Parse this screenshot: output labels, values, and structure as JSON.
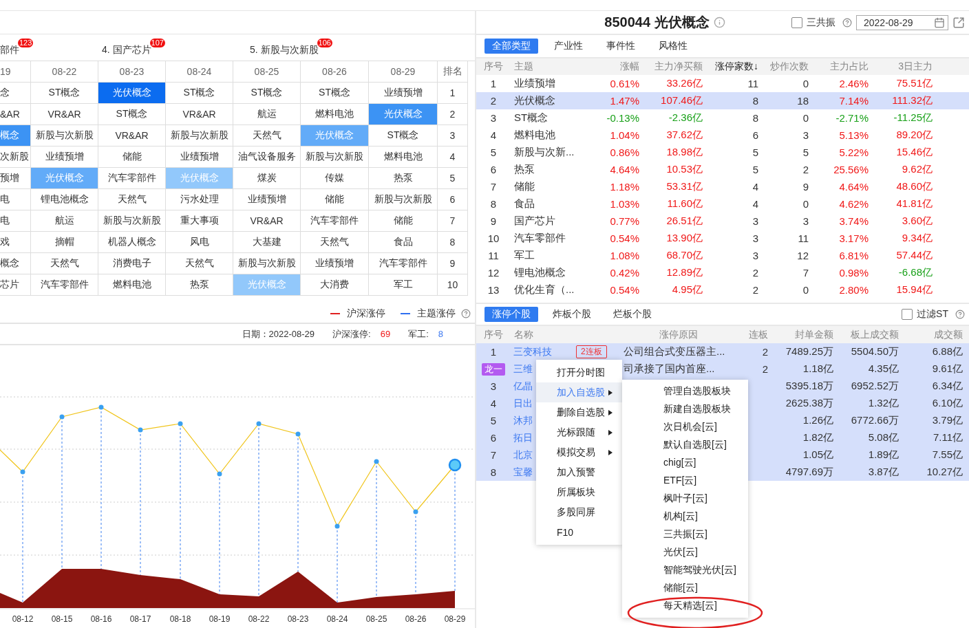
{
  "left_tabs": [
    {
      "label": "部件",
      "badge": "123"
    },
    {
      "label": "4. 国产芯片",
      "badge": "107"
    },
    {
      "label": "5. 新股与次新股",
      "badge": "106"
    }
  ],
  "rank_table": {
    "columns": [
      "19",
      "08-22",
      "08-23",
      "08-24",
      "08-25",
      "08-26",
      "08-29",
      "排名"
    ],
    "rows": [
      {
        "rank": "1",
        "cells": [
          {
            "text": "念",
            "selected": false
          },
          {
            "text": "ST概念",
            "selected": false
          },
          {
            "text": "光伏概念",
            "selected": true,
            "color": "#0b6cf0"
          },
          {
            "text": "ST概念",
            "selected": false
          },
          {
            "text": "ST概念",
            "selected": false
          },
          {
            "text": "ST概念",
            "selected": false
          },
          {
            "text": "业绩预增",
            "selected": false
          }
        ]
      },
      {
        "rank": "2",
        "cells": [
          {
            "text": "&AR",
            "selected": false
          },
          {
            "text": "VR&AR",
            "selected": false
          },
          {
            "text": "ST概念",
            "selected": false
          },
          {
            "text": "VR&AR",
            "selected": false
          },
          {
            "text": "航运",
            "selected": false
          },
          {
            "text": "燃料电池",
            "selected": false
          },
          {
            "text": "光伏概念",
            "selected": true,
            "color": "#3c93f4"
          }
        ]
      },
      {
        "rank": "3",
        "cells": [
          {
            "text": "概念",
            "selected": true,
            "color": "#3c93f4"
          },
          {
            "text": "新股与次新股",
            "selected": false
          },
          {
            "text": "VR&AR",
            "selected": false
          },
          {
            "text": "新股与次新股",
            "selected": false
          },
          {
            "text": "天然气",
            "selected": false
          },
          {
            "text": "光伏概念",
            "selected": true,
            "color": "#62abf8"
          },
          {
            "text": "ST概念",
            "selected": false
          }
        ]
      },
      {
        "rank": "4",
        "cells": [
          {
            "text": "次新股",
            "selected": false
          },
          {
            "text": "业绩预增",
            "selected": false
          },
          {
            "text": "储能",
            "selected": false
          },
          {
            "text": "业绩预增",
            "selected": false
          },
          {
            "text": "油气设备服务",
            "selected": false
          },
          {
            "text": "新股与次新股",
            "selected": false
          },
          {
            "text": "燃料电池",
            "selected": false
          }
        ]
      },
      {
        "rank": "5",
        "cells": [
          {
            "text": "预增",
            "selected": false
          },
          {
            "text": "光伏概念",
            "selected": true,
            "color": "#62abf8"
          },
          {
            "text": "汽车零部件",
            "selected": false
          },
          {
            "text": "光伏概念",
            "selected": true,
            "color": "#92c8fb"
          },
          {
            "text": "煤炭",
            "selected": false
          },
          {
            "text": "传媒",
            "selected": false
          },
          {
            "text": "热泵",
            "selected": false
          }
        ]
      },
      {
        "rank": "6",
        "cells": [
          {
            "text": "电",
            "selected": false
          },
          {
            "text": "锂电池概念",
            "selected": false
          },
          {
            "text": "天然气",
            "selected": false
          },
          {
            "text": "污水处理",
            "selected": false
          },
          {
            "text": "业绩预增",
            "selected": false
          },
          {
            "text": "储能",
            "selected": false
          },
          {
            "text": "新股与次新股",
            "selected": false
          }
        ]
      },
      {
        "rank": "7",
        "cells": [
          {
            "text": "电",
            "selected": false
          },
          {
            "text": "航运",
            "selected": false
          },
          {
            "text": "新股与次新股",
            "selected": false
          },
          {
            "text": "重大事项",
            "selected": false
          },
          {
            "text": "VR&AR",
            "selected": false
          },
          {
            "text": "汽车零部件",
            "selected": false
          },
          {
            "text": "储能",
            "selected": false
          }
        ]
      },
      {
        "rank": "8",
        "cells": [
          {
            "text": "戏",
            "selected": false
          },
          {
            "text": "摘帽",
            "selected": false
          },
          {
            "text": "机器人概念",
            "selected": false
          },
          {
            "text": "风电",
            "selected": false
          },
          {
            "text": "大基建",
            "selected": false
          },
          {
            "text": "天然气",
            "selected": false
          },
          {
            "text": "食品",
            "selected": false
          }
        ]
      },
      {
        "rank": "9",
        "cells": [
          {
            "text": "概念",
            "selected": false
          },
          {
            "text": "天然气",
            "selected": false
          },
          {
            "text": "消费电子",
            "selected": false
          },
          {
            "text": "天然气",
            "selected": false
          },
          {
            "text": "新股与次新股",
            "selected": false
          },
          {
            "text": "业绩预增",
            "selected": false
          },
          {
            "text": "汽车零部件",
            "selected": false
          }
        ]
      },
      {
        "rank": "10",
        "cells": [
          {
            "text": "芯片",
            "selected": false
          },
          {
            "text": "汽车零部件",
            "selected": false
          },
          {
            "text": "燃料电池",
            "selected": false
          },
          {
            "text": "热泵",
            "selected": false
          },
          {
            "text": "光伏概念",
            "selected": true,
            "color": "#92c8fb"
          },
          {
            "text": "大消费",
            "selected": false
          },
          {
            "text": "军工",
            "selected": false
          }
        ]
      }
    ]
  },
  "legend": [
    {
      "label": "沪深涨停",
      "color": "#e02020"
    },
    {
      "label": "主题涨停",
      "color": "#2f6ff0"
    }
  ],
  "info": {
    "date": "日期：2022-08-29",
    "stats": [
      {
        "label": "沪深涨停:",
        "value": "69",
        "color": "#f01818"
      },
      {
        "label": "军工:",
        "value": "8",
        "color": "#3c78f0"
      }
    ]
  },
  "chart": {
    "x_labels": [
      "08-12",
      "08-15",
      "08-16",
      "08-17",
      "08-18",
      "08-19",
      "08-22",
      "08-23",
      "08-24",
      "08-25",
      "08-26",
      "08-29"
    ]
  },
  "theme_panel": {
    "title": "850044 光伏概念",
    "resonance": {
      "label": "三共振",
      "checked": false
    },
    "date": "2022-08-29",
    "tabs": [
      {
        "label": "全部类型",
        "selected": true
      },
      {
        "label": "产业性",
        "selected": false
      },
      {
        "label": "事件性",
        "selected": false
      },
      {
        "label": "风格性",
        "selected": false
      }
    ],
    "columns": [
      {
        "label": "序号",
        "sorted": false
      },
      {
        "label": "主题",
        "sorted": false
      },
      {
        "label": "涨幅",
        "sorted": false
      },
      {
        "label": "主力净买额",
        "sorted": false
      },
      {
        "label": "涨停家数↓",
        "sorted": true
      },
      {
        "label": "炒作次数",
        "sorted": false
      },
      {
        "label": "主力占比",
        "sorted": false
      },
      {
        "label": "3日主力",
        "sorted": false
      }
    ],
    "rows": [
      {
        "no": "1",
        "theme": "业绩预增",
        "change": "0.61%",
        "net": "33.26亿",
        "count": "11",
        "times": "0",
        "ratio": "2.46%",
        "three_day": "75.51亿",
        "selected": false
      },
      {
        "no": "2",
        "theme": "光伏概念",
        "change": "1.47%",
        "net": "107.46亿",
        "count": "8",
        "times": "18",
        "ratio": "7.14%",
        "three_day": "111.32亿",
        "selected": true
      },
      {
        "no": "3",
        "theme": "ST概念",
        "change": "-0.13%",
        "net": "-2.36亿",
        "count": "8",
        "times": "0",
        "ratio": "-2.71%",
        "three_day": "-11.25亿",
        "selected": false
      },
      {
        "no": "4",
        "theme": "燃料电池",
        "change": "1.04%",
        "net": "37.62亿",
        "count": "6",
        "times": "3",
        "ratio": "5.13%",
        "three_day": "89.20亿",
        "selected": false
      },
      {
        "no": "5",
        "theme": "新股与次新...",
        "change": "0.86%",
        "net": "18.98亿",
        "count": "5",
        "times": "5",
        "ratio": "5.22%",
        "three_day": "15.46亿",
        "selected": false
      },
      {
        "no": "6",
        "theme": "热泵",
        "change": "4.64%",
        "net": "10.53亿",
        "count": "5",
        "times": "2",
        "ratio": "25.56%",
        "three_day": "9.62亿",
        "selected": false
      },
      {
        "no": "7",
        "theme": "储能",
        "change": "1.18%",
        "net": "53.31亿",
        "count": "4",
        "times": "9",
        "ratio": "4.64%",
        "three_day": "48.60亿",
        "selected": false
      },
      {
        "no": "8",
        "theme": "食品",
        "change": "1.03%",
        "net": "11.60亿",
        "count": "4",
        "times": "0",
        "ratio": "4.62%",
        "three_day": "41.81亿",
        "selected": false
      },
      {
        "no": "9",
        "theme": "国产芯片",
        "change": "0.77%",
        "net": "26.51亿",
        "count": "3",
        "times": "3",
        "ratio": "3.74%",
        "three_day": "3.60亿",
        "selected": false
      },
      {
        "no": "10",
        "theme": "汽车零部件",
        "change": "0.54%",
        "net": "13.90亿",
        "count": "3",
        "times": "11",
        "ratio": "3.17%",
        "three_day": "9.34亿",
        "selected": false
      },
      {
        "no": "11",
        "theme": "军工",
        "change": "1.08%",
        "net": "68.70亿",
        "count": "3",
        "times": "12",
        "ratio": "6.81%",
        "three_day": "57.44亿",
        "selected": false
      },
      {
        "no": "12",
        "theme": "锂电池概念",
        "change": "0.42%",
        "net": "12.89亿",
        "count": "2",
        "times": "7",
        "ratio": "0.98%",
        "three_day": "-6.68亿",
        "selected": false
      },
      {
        "no": "13",
        "theme": "优化生育（...",
        "change": "0.54%",
        "net": "4.95亿",
        "count": "2",
        "times": "0",
        "ratio": "2.80%",
        "three_day": "15.94亿",
        "selected": false
      }
    ]
  },
  "stock_panel": {
    "tabs": [
      {
        "label": "涨停个股",
        "selected": true
      },
      {
        "label": "炸板个股",
        "selected": false
      },
      {
        "label": "烂板个股",
        "selected": false
      }
    ],
    "filter": {
      "label": "过滤ST",
      "checked": false
    },
    "columns": [
      "序号",
      "名称",
      "涨停原因",
      "连板",
      "封单金额",
      "板上成交额",
      "成交额"
    ],
    "rows": [
      {
        "no": "1",
        "name": "三变科技",
        "tag": "2连板",
        "reason": "公司组合式变压器主...",
        "streak": "2",
        "seal": "7489.25万",
        "board_turnover": "5504.50万",
        "turnover": "6.88亿",
        "selected": true
      },
      {
        "badge": "龙一",
        "name": "三维",
        "reason": "司承接了国内首座...",
        "streak": "2",
        "seal": "1.18亿",
        "board_turnover": "4.35亿",
        "turnover": "9.61亿",
        "selected": true
      },
      {
        "no": "3",
        "name": "亿晶",
        "seal": "5395.18万",
        "board_turnover": "6952.52万",
        "turnover": "6.34亿",
        "selected": true
      },
      {
        "no": "4",
        "name": "日出",
        "seal": "2625.38万",
        "board_turnover": "1.32亿",
        "turnover": "6.10亿",
        "selected": true
      },
      {
        "no": "5",
        "name": "沐邦",
        "seal": "1.26亿",
        "board_turnover": "6772.66万",
        "turnover": "3.79亿",
        "selected": true
      },
      {
        "no": "6",
        "name": "拓日",
        "seal": "1.82亿",
        "board_turnover": "5.08亿",
        "turnover": "7.11亿",
        "selected": true
      },
      {
        "no": "7",
        "name": "北京",
        "seal": "1.05亿",
        "board_turnover": "1.89亿",
        "turnover": "7.55亿",
        "selected": true
      },
      {
        "no": "8",
        "name": "宝馨",
        "seal": "4797.69万",
        "board_turnover": "3.87亿",
        "turnover": "10.27亿",
        "selected": true
      }
    ]
  },
  "context_menu": {
    "items": [
      {
        "label": "打开分时图",
        "submenu": false,
        "selected": false
      },
      {
        "label": "加入自选股",
        "submenu": true,
        "selected": true
      },
      {
        "label": "删除自选股",
        "submenu": true,
        "selected": false
      },
      {
        "label": "光标跟随",
        "submenu": true,
        "selected": false
      },
      {
        "label": "模拟交易",
        "submenu": true,
        "selected": false
      },
      {
        "label": "加入预警",
        "submenu": false,
        "selected": false
      },
      {
        "label": "所属板块",
        "submenu": false,
        "selected": false
      },
      {
        "label": "多股同屏",
        "submenu": false,
        "selected": false
      },
      {
        "label": "F10",
        "submenu": false,
        "selected": false
      }
    ],
    "submenu_items": [
      {
        "label": "管理自选股板块",
        "selected": false
      },
      {
        "label": "新建自选股板块",
        "selected": false
      },
      {
        "label": "次日机会[云]",
        "selected": false
      },
      {
        "label": "默认自选股[云]",
        "selected": false
      },
      {
        "label": "chig[云]",
        "selected": false
      },
      {
        "label": "ETF[云]",
        "selected": false
      },
      {
        "label": "枫叶子[云]",
        "selected": false
      },
      {
        "label": "机构[云]",
        "selected": false
      },
      {
        "label": "三共振[云]",
        "selected": false
      },
      {
        "label": "光伏[云]",
        "selected": false
      },
      {
        "label": "智能驾驶光伏[云]",
        "selected": false
      },
      {
        "label": "储能[云]",
        "selected": false
      },
      {
        "label": "每天精选[云]",
        "selected": false
      }
    ]
  },
  "annotations": [
    {
      "kind": "ellipse",
      "color": "#e02020"
    }
  ]
}
